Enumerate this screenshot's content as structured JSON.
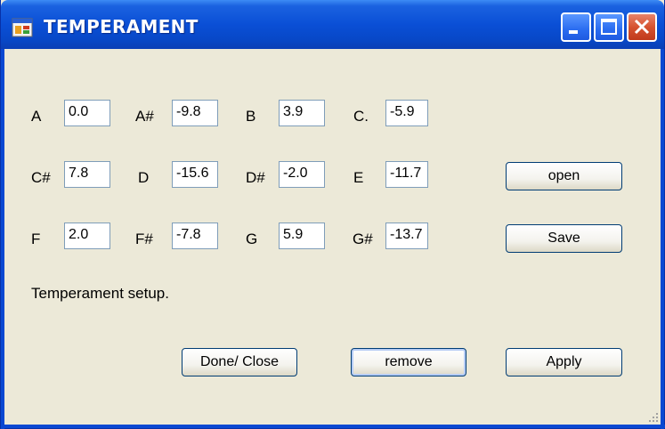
{
  "window": {
    "title": "TEMPERAMENT"
  },
  "notes": [
    {
      "label": "A",
      "value": "0.0"
    },
    {
      "label": "A#",
      "value": "-9.8"
    },
    {
      "label": "B",
      "value": "3.9"
    },
    {
      "label": "C.",
      "value": "-5.9"
    },
    {
      "label": "C#",
      "value": "7.8"
    },
    {
      "label": "D",
      "value": "-15.6"
    },
    {
      "label": "D#",
      "value": "-2.0"
    },
    {
      "label": "E",
      "value": "-11.7"
    },
    {
      "label": "F",
      "value": "2.0"
    },
    {
      "label": "F#",
      "value": "-7.8"
    },
    {
      "label": "G",
      "value": "5.9"
    },
    {
      "label": "G#",
      "value": "-13.7"
    }
  ],
  "buttons": {
    "open": "open",
    "save": "Save",
    "done_close": "Done/ Close",
    "remove": "remove",
    "apply": "Apply"
  },
  "status": "Temperament setup.",
  "colors": {
    "titlebar": "#0a4fd6",
    "face": "#ece9d8",
    "close": "#d65230"
  }
}
